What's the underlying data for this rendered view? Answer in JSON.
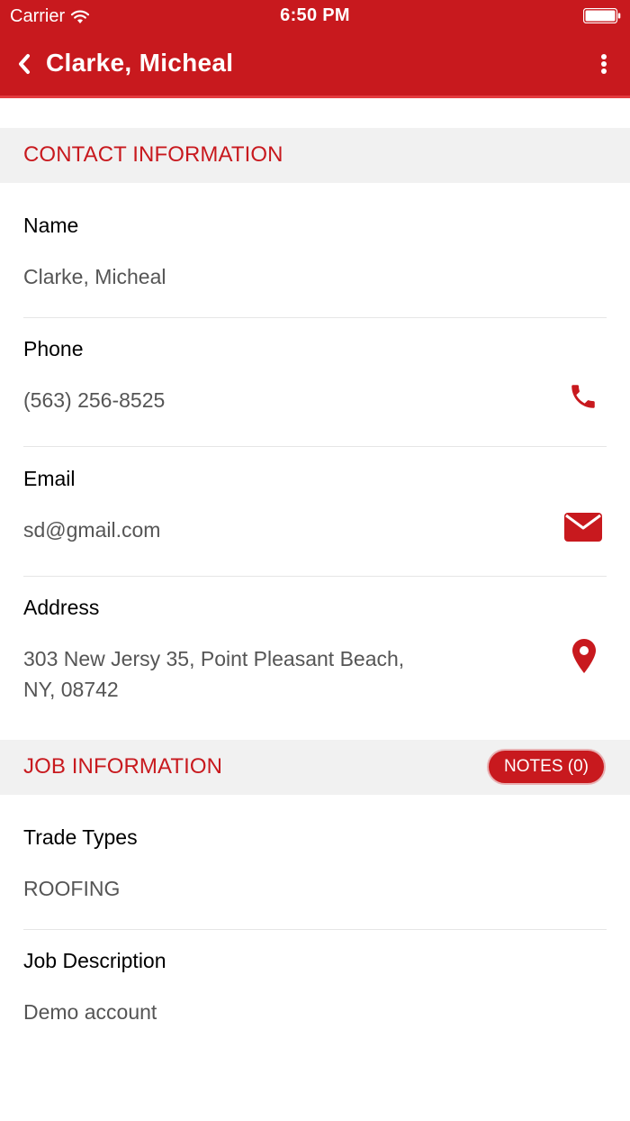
{
  "status_bar": {
    "carrier": "Carrier",
    "time": "6:50 PM"
  },
  "nav": {
    "title": "Clarke, Micheal"
  },
  "contact_section": {
    "title": "CONTACT INFORMATION",
    "name_label": "Name",
    "name_value": "Clarke, Micheal",
    "phone_label": "Phone",
    "phone_value": "(563) 256-8525",
    "email_label": "Email",
    "email_value": "sd@gmail.com",
    "address_label": "Address",
    "address_line1": "303 New Jersy 35, Point Pleasant Beach,",
    "address_line2": "NY, 08742"
  },
  "job_section": {
    "title": "JOB INFORMATION",
    "notes_button": "NOTES (0)",
    "trade_label": "Trade Types",
    "trade_value": "ROOFING",
    "description_label": "Job Description",
    "description_value": "Demo account"
  },
  "icons": {
    "back": "chevron-left-icon",
    "more": "vertical-ellipsis-icon",
    "phone": "phone-icon",
    "email": "envelope-icon",
    "address": "map-pin-icon"
  },
  "colors": {
    "accent": "#c8191e",
    "section_bg": "#f1f1f1",
    "value_text": "#555555"
  }
}
